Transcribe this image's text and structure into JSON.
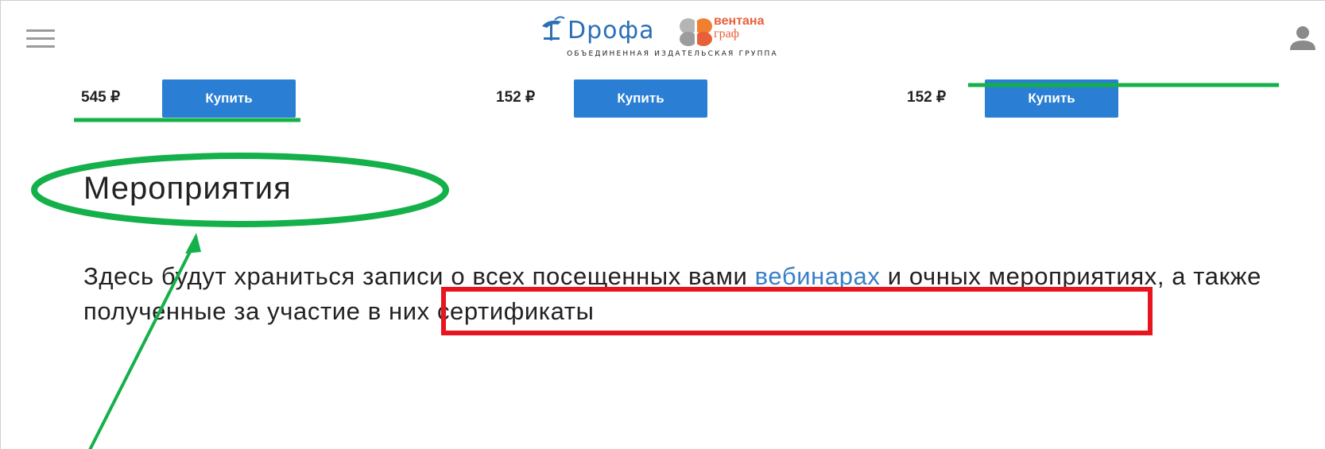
{
  "header": {
    "menu_icon": "hamburger-menu-icon",
    "user_icon": "user-account-icon",
    "logo": {
      "brand_left": "Dpoфa",
      "brand_right_line1": "вентана",
      "brand_right_line2": "граф",
      "subtitle": "ОБЪЕДИНЕННАЯ ИЗДАТЕЛЬСКАЯ ГРУППА"
    }
  },
  "products": [
    {
      "price": "545 ₽",
      "button_label": "Купить"
    },
    {
      "price": "152 ₽",
      "button_label": "Купить"
    },
    {
      "price": "152 ₽",
      "button_label": "Купить"
    }
  ],
  "main": {
    "title": "Мероприятия",
    "paragraph_part1": "Здесь будут храниться записи о всех посещенных вами ",
    "paragraph_link": "вебинарах",
    "paragraph_part2": " и очных мероприятиях, а также ",
    "paragraph_highlight": "полученные за участие в них сертификаты"
  },
  "colors": {
    "button_blue": "#2a7fd4",
    "link_blue": "#3a80c8",
    "annotation_green": "#14b04a",
    "annotation_red": "#e8141e",
    "logo_blue": "#2d6fb6",
    "logo_orange": "#e8603a"
  }
}
